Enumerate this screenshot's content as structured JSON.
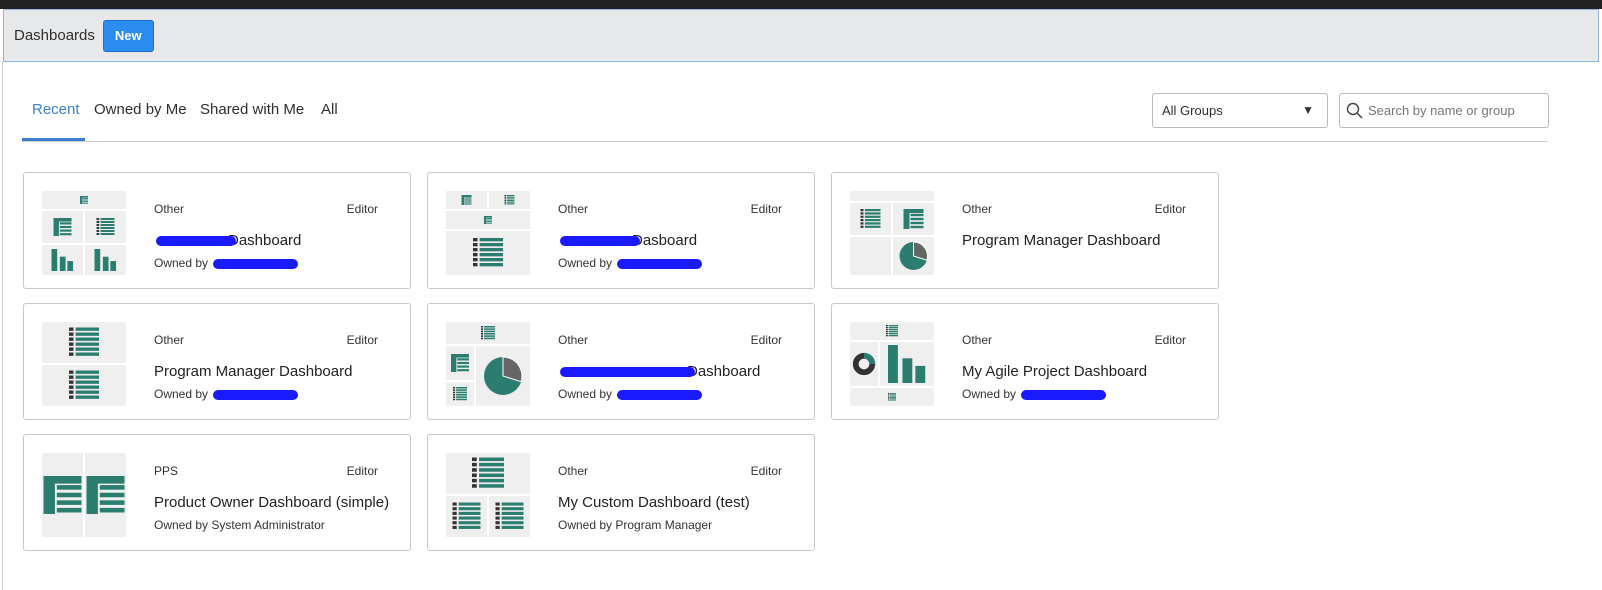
{
  "header": {
    "title": "Dashboards",
    "new_label": "New"
  },
  "tabs": [
    {
      "label": "Recent",
      "active": true
    },
    {
      "label": "Owned by Me"
    },
    {
      "label": "Shared with Me"
    },
    {
      "label": "All"
    }
  ],
  "group_select": {
    "value": "All Groups"
  },
  "search": {
    "placeholder": "Search by name or group"
  },
  "accent_color": "#2b8cf0",
  "widget_color": "#2a7d6f",
  "cards": [
    {
      "category": "Other",
      "role": "Editor",
      "name": "Dashboard",
      "name_redacted": true,
      "owner_prefix": "Owned by",
      "owner": "",
      "owner_redacted": true,
      "widgets": [
        "table",
        "list",
        "bar-chart",
        "bar-chart"
      ]
    },
    {
      "category": "Other",
      "role": "Editor",
      "name": "Dasboard",
      "name_redacted": true,
      "owner_prefix": "Owned by",
      "owner": "",
      "owner_redacted": true,
      "widgets": [
        "table",
        "list",
        "table",
        "list"
      ]
    },
    {
      "category": "Other",
      "role": "Editor",
      "name": "Program Manager Dashboard",
      "owner_prefix": "",
      "owner": "",
      "widgets": [
        "list",
        "table",
        "pie-chart"
      ]
    },
    {
      "category": "Other",
      "role": "Editor",
      "name": "Program Manager Dashboard",
      "owner_prefix": "Owned by",
      "owner": "",
      "owner_redacted": true,
      "widgets": [
        "list",
        "list"
      ]
    },
    {
      "category": "Other",
      "role": "Editor",
      "name": "Dashboard",
      "name_redacted": true,
      "owner_prefix": "Owned by",
      "owner": "",
      "owner_redacted": true,
      "widgets": [
        "list",
        "table",
        "pie-chart",
        "list"
      ]
    },
    {
      "category": "Other",
      "role": "Editor",
      "name": "My Agile Project Dashboard",
      "owner_prefix": "Owned by",
      "owner": "",
      "owner_redacted": true,
      "widgets": [
        "list",
        "donut-chart",
        "bar-chart",
        "list"
      ]
    },
    {
      "category": "PPS",
      "role": "Editor",
      "name": "Product Owner Dashboard (simple)",
      "owner_prefix": "Owned by",
      "owner": "System Administrator",
      "widgets": [
        "table",
        "table"
      ]
    },
    {
      "category": "Other",
      "role": "Editor",
      "name": "My Custom Dashboard (test)",
      "owner_prefix": "Owned by",
      "owner": "Program Manager",
      "widgets": [
        "list",
        "list",
        "list"
      ]
    }
  ]
}
